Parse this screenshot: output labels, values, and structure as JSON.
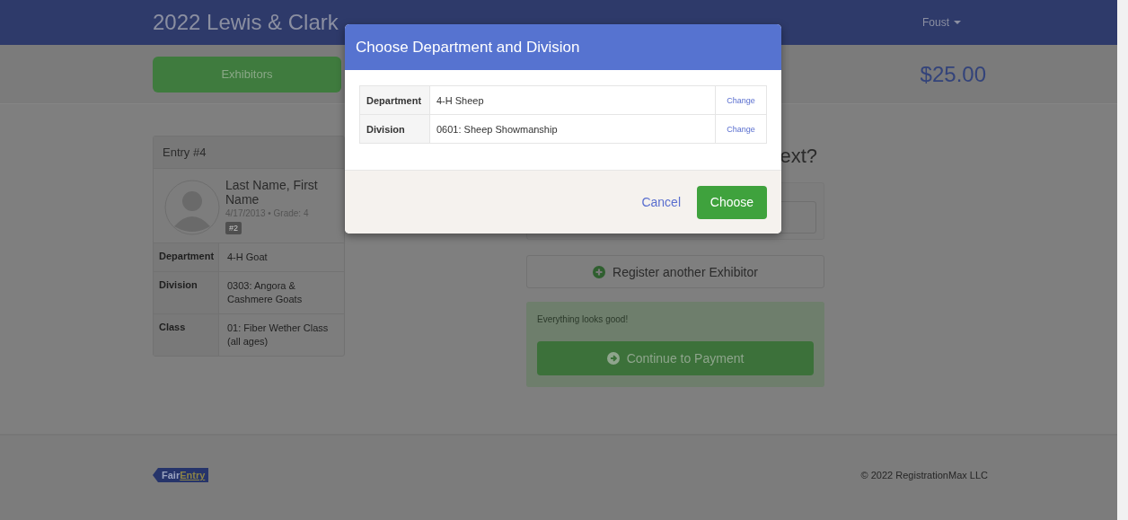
{
  "header": {
    "title": "2022 Lewis & Clark",
    "user_menu": "Foust"
  },
  "nav": {
    "tabs": [
      {
        "label": "Exhibitors",
        "selected": true
      }
    ],
    "total": "$25.00"
  },
  "entry": {
    "title": "Entry #4",
    "name": "Last Name, First Name",
    "details": "4/17/2013 • Grade: 4",
    "badge": "#2",
    "fields": [
      {
        "label": "Department",
        "value": "4-H Goat"
      },
      {
        "label": "Division",
        "value": "0303: Angora & Cashmere Goats"
      },
      {
        "label": "Class",
        "value": "01: Fiber Wether Class (all ages)"
      }
    ]
  },
  "next": {
    "heading": "ext?",
    "register_button": "Register another Exhibitor",
    "status": {
      "message": "Everything looks good!",
      "button": "Continue to Payment"
    }
  },
  "modal": {
    "title": "Choose Department and Division",
    "rows": [
      {
        "label": "Department",
        "value": "4-H Sheep",
        "action": "Change"
      },
      {
        "label": "Division",
        "value": "0601: Sheep Showmanship",
        "action": "Change"
      }
    ],
    "buttons": [
      {
        "label": "Cancel",
        "kind": "link"
      },
      {
        "label": "Choose",
        "kind": "primary"
      }
    ]
  },
  "footer": {
    "logo": {
      "text": "Fair",
      "accent": "Entry"
    },
    "copyright": "© 2022 RegistrationMax LLC"
  }
}
